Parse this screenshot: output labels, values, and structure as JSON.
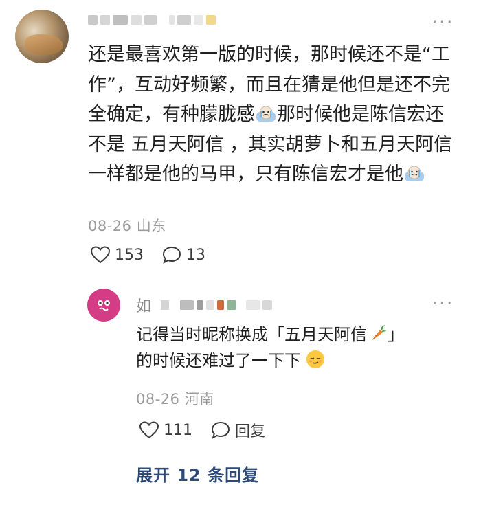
{
  "comment": {
    "text_before_emoji1": "还是最喜欢第一版的时候，那时候还不是“工作”，互动好频繁，而且在猜是他但是还不完全确定，有种朦胧感",
    "text_after_emoji1": "那时候他是陈信宏还不是 五月天阿信 ，其实胡萝卜和五月天阿信一样都是他的马甲，只有陈信宏才是他",
    "date_location": "08-26 山东",
    "likes": "153",
    "replies": "13",
    "more_label": "···"
  },
  "reply": {
    "name_first_char": "如",
    "text_line1_before": "记得当时昵称换成「五月天阿信",
    "text_line1_after": "」",
    "text_line2": "的时候还难过了一下下",
    "date_location": "08-26 河南",
    "likes": "111",
    "reply_label": "回复",
    "more_label": "···"
  },
  "expand_label": "展开 12 条回复",
  "colors": {
    "text": "#1f1f1f",
    "meta": "#9b9b9b",
    "link": "#2e4a78",
    "avatar_reply": "#d43d86"
  }
}
